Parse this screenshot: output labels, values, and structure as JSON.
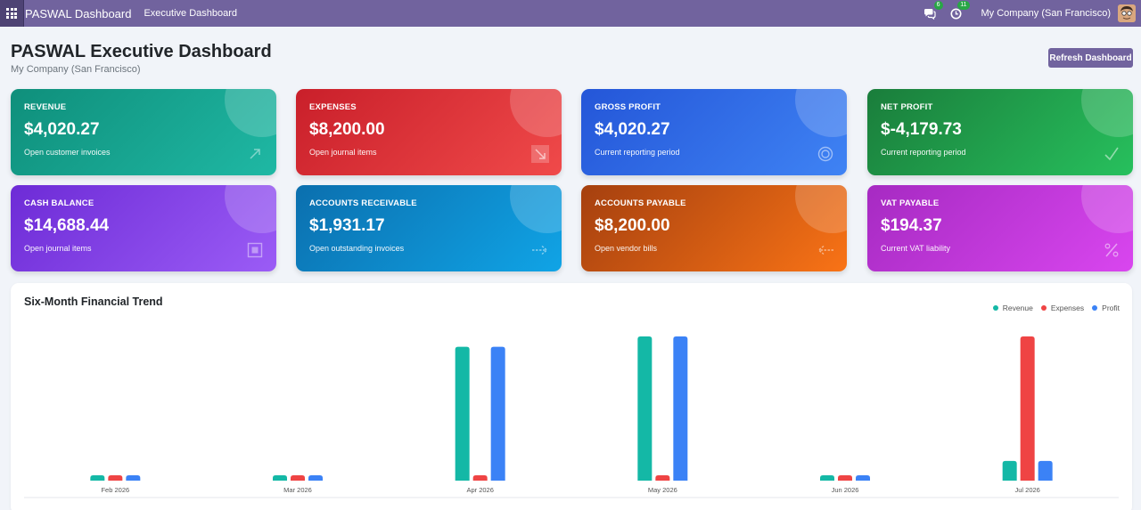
{
  "navbar": {
    "brand": "PASWAL Dashboard",
    "menu_item": "Executive Dashboard",
    "messages_badge": "6",
    "activities_badge": "11",
    "company": "My Company (San Francisco)"
  },
  "header": {
    "title": "PASWAL Executive Dashboard",
    "subtitle": "My Company (San Francisco)",
    "refresh_label": "Refresh Dashboard"
  },
  "cards": [
    {
      "label": "REVENUE",
      "value": "$4,020.27",
      "sub": "Open customer invoices",
      "icon": "trend-up-icon"
    },
    {
      "label": "EXPENSES",
      "value": "$8,200.00",
      "sub": "Open journal items",
      "icon": "trend-down-icon"
    },
    {
      "label": "GROSS PROFIT",
      "value": "$4,020.27",
      "sub": "Current reporting period",
      "icon": "target-icon"
    },
    {
      "label": "NET PROFIT",
      "value": "$-4,179.73",
      "sub": "Current reporting period",
      "icon": "check-icon"
    },
    {
      "label": "CASH BALANCE",
      "value": "$14,688.44",
      "sub": "Open journal items",
      "icon": "box-icon"
    },
    {
      "label": "ACCOUNTS RECEIVABLE",
      "value": "$1,931.17",
      "sub": "Open outstanding invoices",
      "icon": "arrow-right-icon"
    },
    {
      "label": "ACCOUNTS PAYABLE",
      "value": "$8,200.00",
      "sub": "Open vendor bills",
      "icon": "arrow-left-icon"
    },
    {
      "label": "VAT PAYABLE",
      "value": "$194.37",
      "sub": "Current VAT liability",
      "icon": "percent-icon"
    }
  ],
  "colors": {
    "revenue": "#14b8a6",
    "expenses": "#ef4444",
    "profit": "#3b82f6",
    "navbar": "#71639e"
  },
  "chart_data": {
    "type": "bar",
    "title": "Six-Month Financial Trend",
    "categories": [
      "Feb 2026",
      "Mar 2026",
      "Apr 2026",
      "May 2026",
      "Jun 2026",
      "Jul 2026"
    ],
    "series": [
      {
        "name": "Revenue",
        "color": "#14b8a6",
        "values": [
          200,
          200,
          7800,
          8400,
          200,
          1150
        ]
      },
      {
        "name": "Expenses",
        "color": "#ef4444",
        "values": [
          200,
          200,
          300,
          300,
          200,
          8400
        ]
      },
      {
        "name": "Profit",
        "color": "#3b82f6",
        "values": [
          200,
          200,
          7800,
          8400,
          200,
          1150
        ]
      }
    ],
    "ylim": [
      0,
      8400
    ],
    "legend_position": "top-right",
    "grid": false
  }
}
